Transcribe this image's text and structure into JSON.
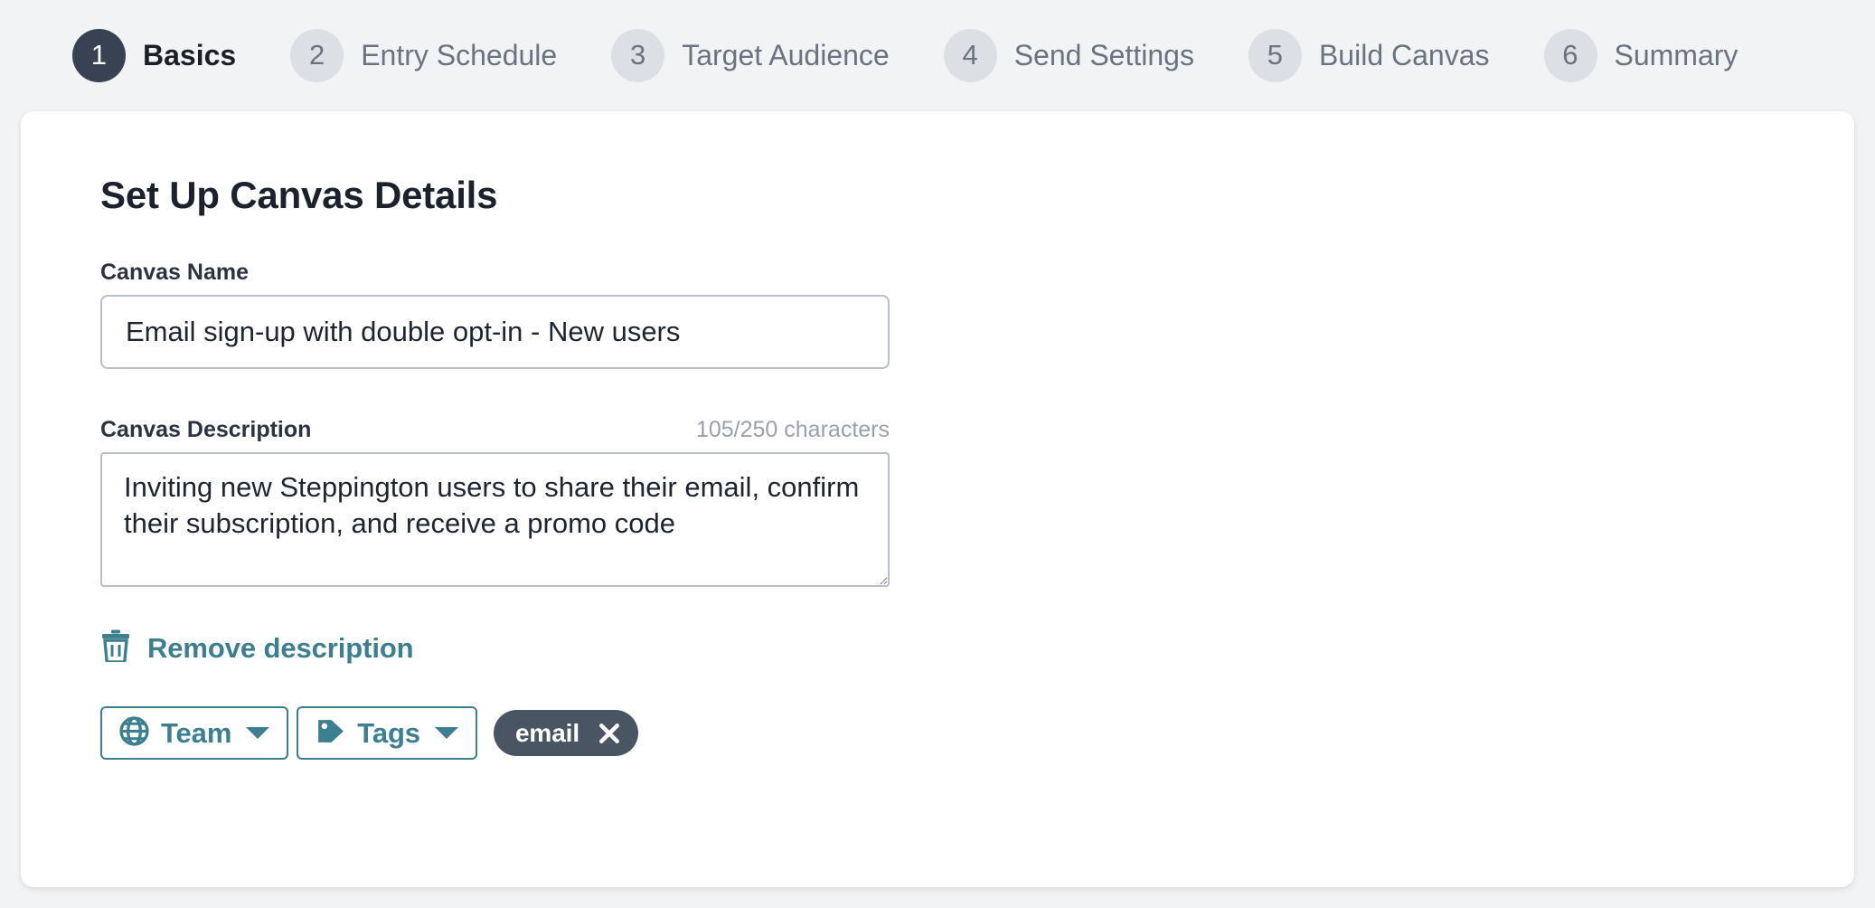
{
  "colors": {
    "page_background": "#f2f3f5",
    "card_background": "#ffffff",
    "accent": "#3b7f91",
    "active_step": "#394253",
    "inactive_step": "#dcdfe4",
    "chip_background": "#4a5563",
    "input_border": "#b9bfc9",
    "muted_text": "#9aa1ac"
  },
  "stepper": {
    "steps": [
      {
        "number": "1",
        "label": "Basics",
        "state": "active"
      },
      {
        "number": "2",
        "label": "Entry Schedule",
        "state": "inactive"
      },
      {
        "number": "3",
        "label": "Target Audience",
        "state": "inactive"
      },
      {
        "number": "4",
        "label": "Send Settings",
        "state": "inactive"
      },
      {
        "number": "5",
        "label": "Build Canvas",
        "state": "inactive"
      },
      {
        "number": "6",
        "label": "Summary",
        "state": "inactive"
      }
    ]
  },
  "card": {
    "title": "Set Up Canvas Details",
    "canvas_name": {
      "label": "Canvas Name",
      "value": "Email sign-up with double opt-in - New users",
      "placeholder": "Canvas Name"
    },
    "canvas_description": {
      "label": "Canvas Description",
      "counter": "105/250 characters",
      "value": "Inviting new Steppington users to share their email, confirm their subscription, and receive a promo code",
      "placeholder": "Canvas Description"
    },
    "remove_description": {
      "label": "Remove description",
      "icon": "trash-icon"
    },
    "team_button": {
      "label": "Team",
      "icon": "globe-icon",
      "caret": "chevron-down-icon"
    },
    "tags_button": {
      "label": "Tags",
      "icon": "tag-icon",
      "caret": "chevron-down-icon"
    },
    "tags": [
      {
        "label": "email",
        "remove_icon": "close-icon"
      }
    ]
  }
}
